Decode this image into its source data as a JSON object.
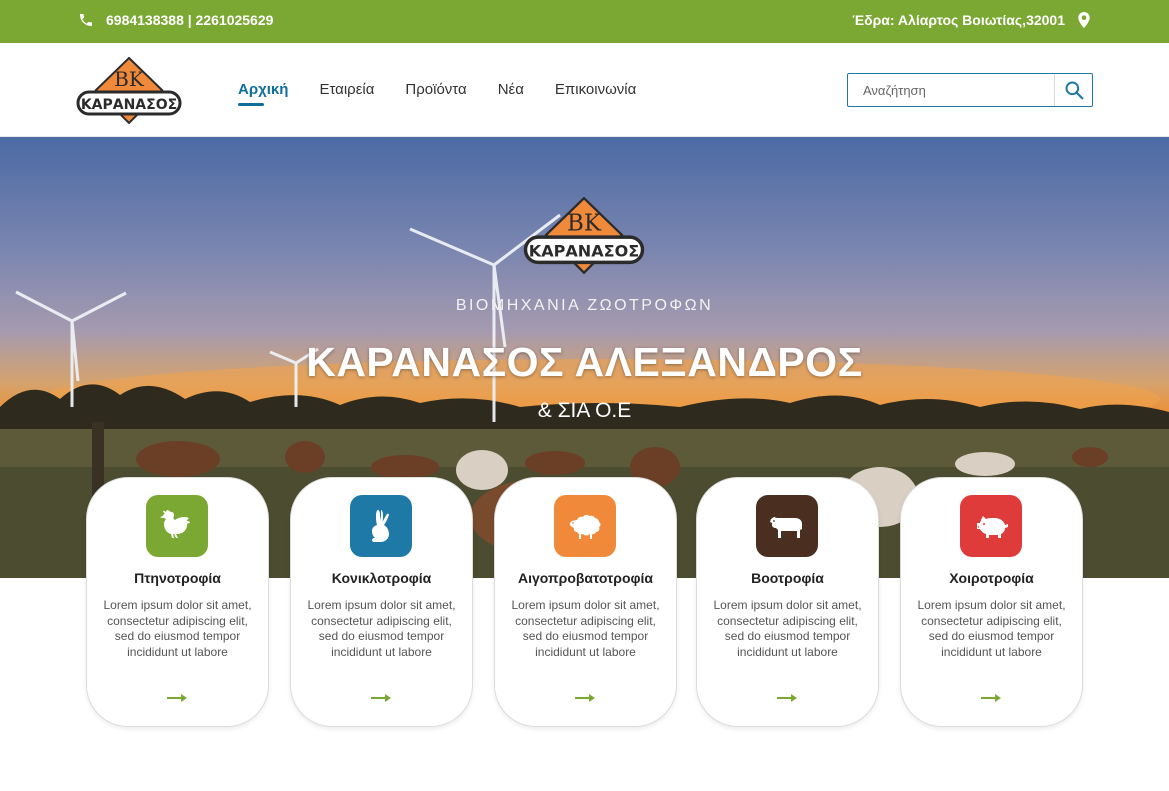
{
  "topbar": {
    "phones": "6984138388 | 2261025629",
    "address": "Έδρα: Αλίαρτος Βοιωτίας,32001",
    "phone_icon": "phone-icon",
    "location_icon": "map-pin-icon"
  },
  "brand": {
    "logo_monogram": "BK",
    "logo_text": "ΚΑΡΑΝΑΣΟΣ"
  },
  "nav": {
    "items": [
      {
        "label": "Αρχική",
        "active": true
      },
      {
        "label": "Εταιρεία"
      },
      {
        "label": "Προϊόντα"
      },
      {
        "label": "Νέα"
      },
      {
        "label": "Επικοινωνία"
      }
    ]
  },
  "search": {
    "placeholder": "Αναζήτηση",
    "value": "",
    "icon": "search-icon"
  },
  "hero": {
    "subtitle": "ΒΙΟΜΗΧΑΝΙΑ ΖΩΟΤΡΟΦΩΝ",
    "title": "ΚΑΡΑΝΑΣΟΣ ΑΛΕΞΑΝΔΡΟΣ",
    "tagline": "& ΣΙΑ Ο.Ε"
  },
  "cards": [
    {
      "title": "Πτηνοτροφία",
      "text": "Lorem ipsum dolor sit amet, consectetur adipiscing elit, sed do eiusmod tempor incididunt ut labore",
      "icon": "chicken-icon",
      "color": "#7aa832"
    },
    {
      "title": "Κονικλοτροφία",
      "text": "Lorem ipsum dolor sit amet, consectetur adipiscing elit, sed do eiusmod tempor incididunt ut labore",
      "icon": "rabbit-icon",
      "color": "#1f79a6"
    },
    {
      "title": "Αιγοπροβατοτροφία",
      "text": "Lorem ipsum dolor sit amet, consectetur adipiscing elit, sed do eiusmod tempor incididunt ut labore",
      "icon": "sheep-icon",
      "color": "#f08a3a"
    },
    {
      "title": "Βοοτροφία",
      "text": "Lorem ipsum dolor sit amet, consectetur adipiscing elit, sed do eiusmod tempor incididunt ut labore",
      "icon": "cow-icon",
      "color": "#4a2e1f"
    },
    {
      "title": "Χοιροτροφία",
      "text": "Lorem ipsum dolor sit amet, consectetur adipiscing elit, sed do eiusmod tempor incididunt ut labore",
      "icon": "pig-icon",
      "color": "#e03b3b"
    }
  ],
  "colors": {
    "accent_green": "#7aa832",
    "nav_active": "#0f6e9a",
    "logo_orange": "#f08a3a"
  }
}
